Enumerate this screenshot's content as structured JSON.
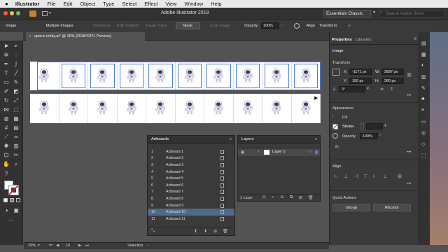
{
  "menubar": {
    "apple": "",
    "items": [
      "Illustrator",
      "File",
      "Edit",
      "Object",
      "Type",
      "Select",
      "Effect",
      "View",
      "Window",
      "Help"
    ]
  },
  "appbar": {
    "title": "Adobe Illustrator 2019",
    "workspace": "Essentials Classic",
    "search_placeholder": "Search Adobe Stock"
  },
  "controlbar": {
    "image": "Image",
    "multiple_images": "Multiple Images",
    "unembed": "Unembed",
    "edit_original": "Edit Original",
    "image_trace": "Image Trace",
    "mask": "Mask",
    "crop_image": "Crop Image",
    "opacity_label": "Opacity:",
    "opacity_value": "100%",
    "align": "Align",
    "transform": "Transform"
  },
  "document": {
    "tab_title": "space-entity.ai* @ 25% (RGB/GPU Preview)"
  },
  "artboards_panel": {
    "title": "Artboards",
    "rows": [
      {
        "num": "1",
        "name": "Artboard 1"
      },
      {
        "num": "2",
        "name": "Artboard 2"
      },
      {
        "num": "3",
        "name": "Artboard 3"
      },
      {
        "num": "4",
        "name": "Artboard 4"
      },
      {
        "num": "5",
        "name": "Artboard 5"
      },
      {
        "num": "6",
        "name": "Artboard 6"
      },
      {
        "num": "7",
        "name": "Artboard 7"
      },
      {
        "num": "8",
        "name": "Artboard 8"
      },
      {
        "num": "9",
        "name": "Artboard 9"
      },
      {
        "num": "10",
        "name": "Artboard 10"
      },
      {
        "num": "11",
        "name": "Artboard 11"
      }
    ],
    "selected_index": 9
  },
  "layers_panel": {
    "title": "Layers",
    "layer_name": "Layer 1",
    "footer": "1 Layer"
  },
  "properties_panel": {
    "tab_properties": "Properties",
    "tab_libraries": "Libraries",
    "selection_type": "Image",
    "transform_title": "Transform",
    "x_label": "X:",
    "x_value": "-1171 px",
    "w_label": "W:",
    "w_value": "2897 px",
    "y_label": "Y:",
    "y_value": "150 px",
    "h_label": "H:",
    "h_value": "260 px",
    "angle_value": "0°",
    "appearance_title": "Appearance",
    "fill_label": "Fill",
    "stroke_label": "Stroke",
    "opacity_label": "Opacity",
    "opacity_value": "100%",
    "fx_label": "fx.",
    "align_title": "Align",
    "quick_actions_title": "Quick Actions",
    "group_button": "Group",
    "recolor_button": "Recolor"
  },
  "statusbar": {
    "zoom": "25%",
    "artboard_number": "10",
    "mode": "Selection"
  },
  "colors": {
    "selection_blue": "#4a7fe0",
    "canvas": "#535353",
    "panel": "#3a3a3a"
  }
}
